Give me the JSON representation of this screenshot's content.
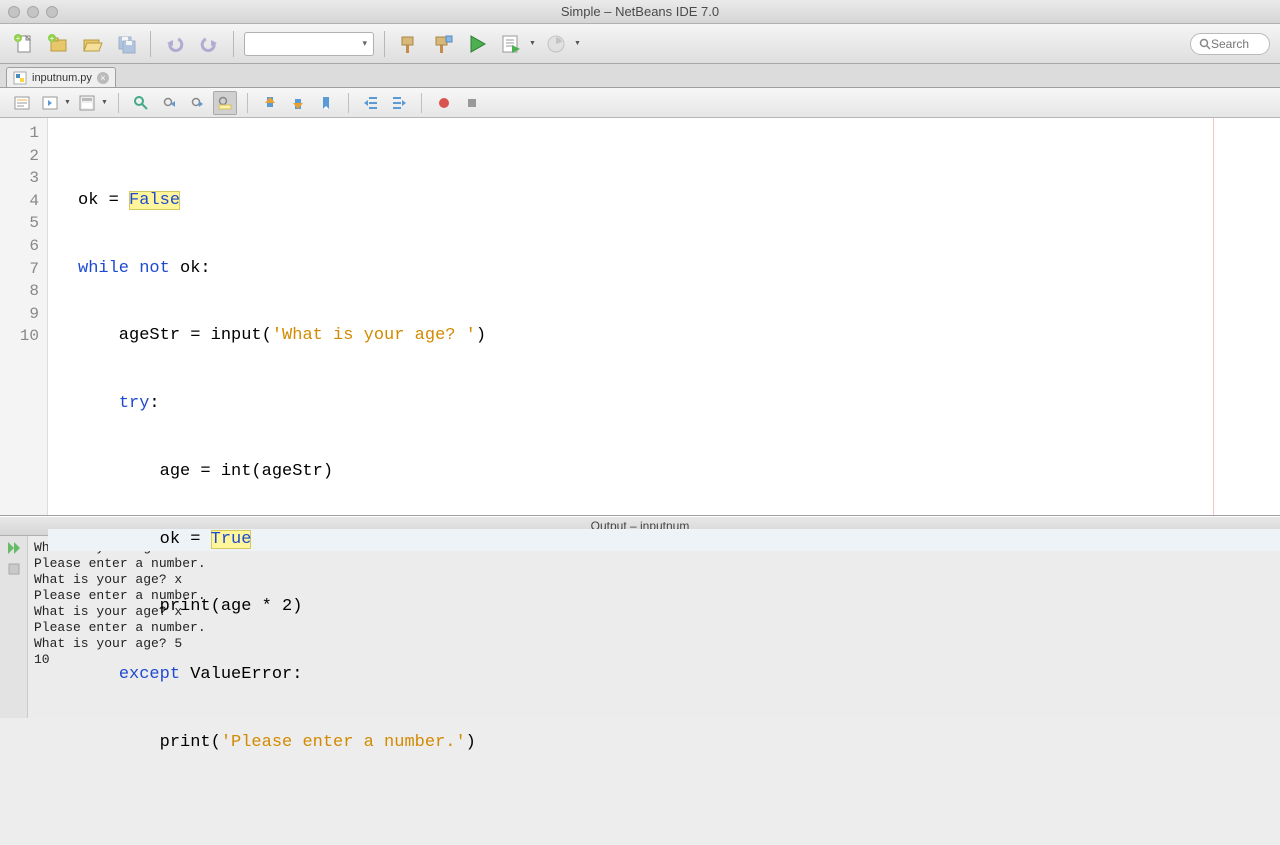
{
  "window": {
    "title": "Simple – NetBeans IDE 7.0"
  },
  "toolbar": {
    "search_placeholder": "Search"
  },
  "tab": {
    "filename": "inputnum.py"
  },
  "editor": {
    "line_numbers": [
      "1",
      "2",
      "3",
      "4",
      "5",
      "6",
      "7",
      "8",
      "9",
      "10"
    ],
    "lines": {
      "l1_a": "ok = ",
      "l1_false": "False",
      "l2_while": "while",
      "l2_not": "not",
      "l2_rest": " ok:",
      "l3_a": "    ageStr = input(",
      "l3_str": "'What is your age? '",
      "l3_b": ")",
      "l4_try": "try",
      "l4_colon": ":",
      "l5": "        age = int(ageStr)",
      "l6_a": "        ok = ",
      "l6_true": "True",
      "l7": "        print(age * 2)",
      "l8_except": "except",
      "l8_rest": " ValueError:",
      "l9_a": "        print(",
      "l9_str": "'Please enter a number.'",
      "l9_b": ")",
      "l10": ""
    }
  },
  "output": {
    "title": "Output – inputnum",
    "text": "What is your age? x\nPlease enter a number.\nWhat is your age? x\nPlease enter a number.\nWhat is your age? x\nPlease enter a number.\nWhat is your age? 5\n10"
  }
}
